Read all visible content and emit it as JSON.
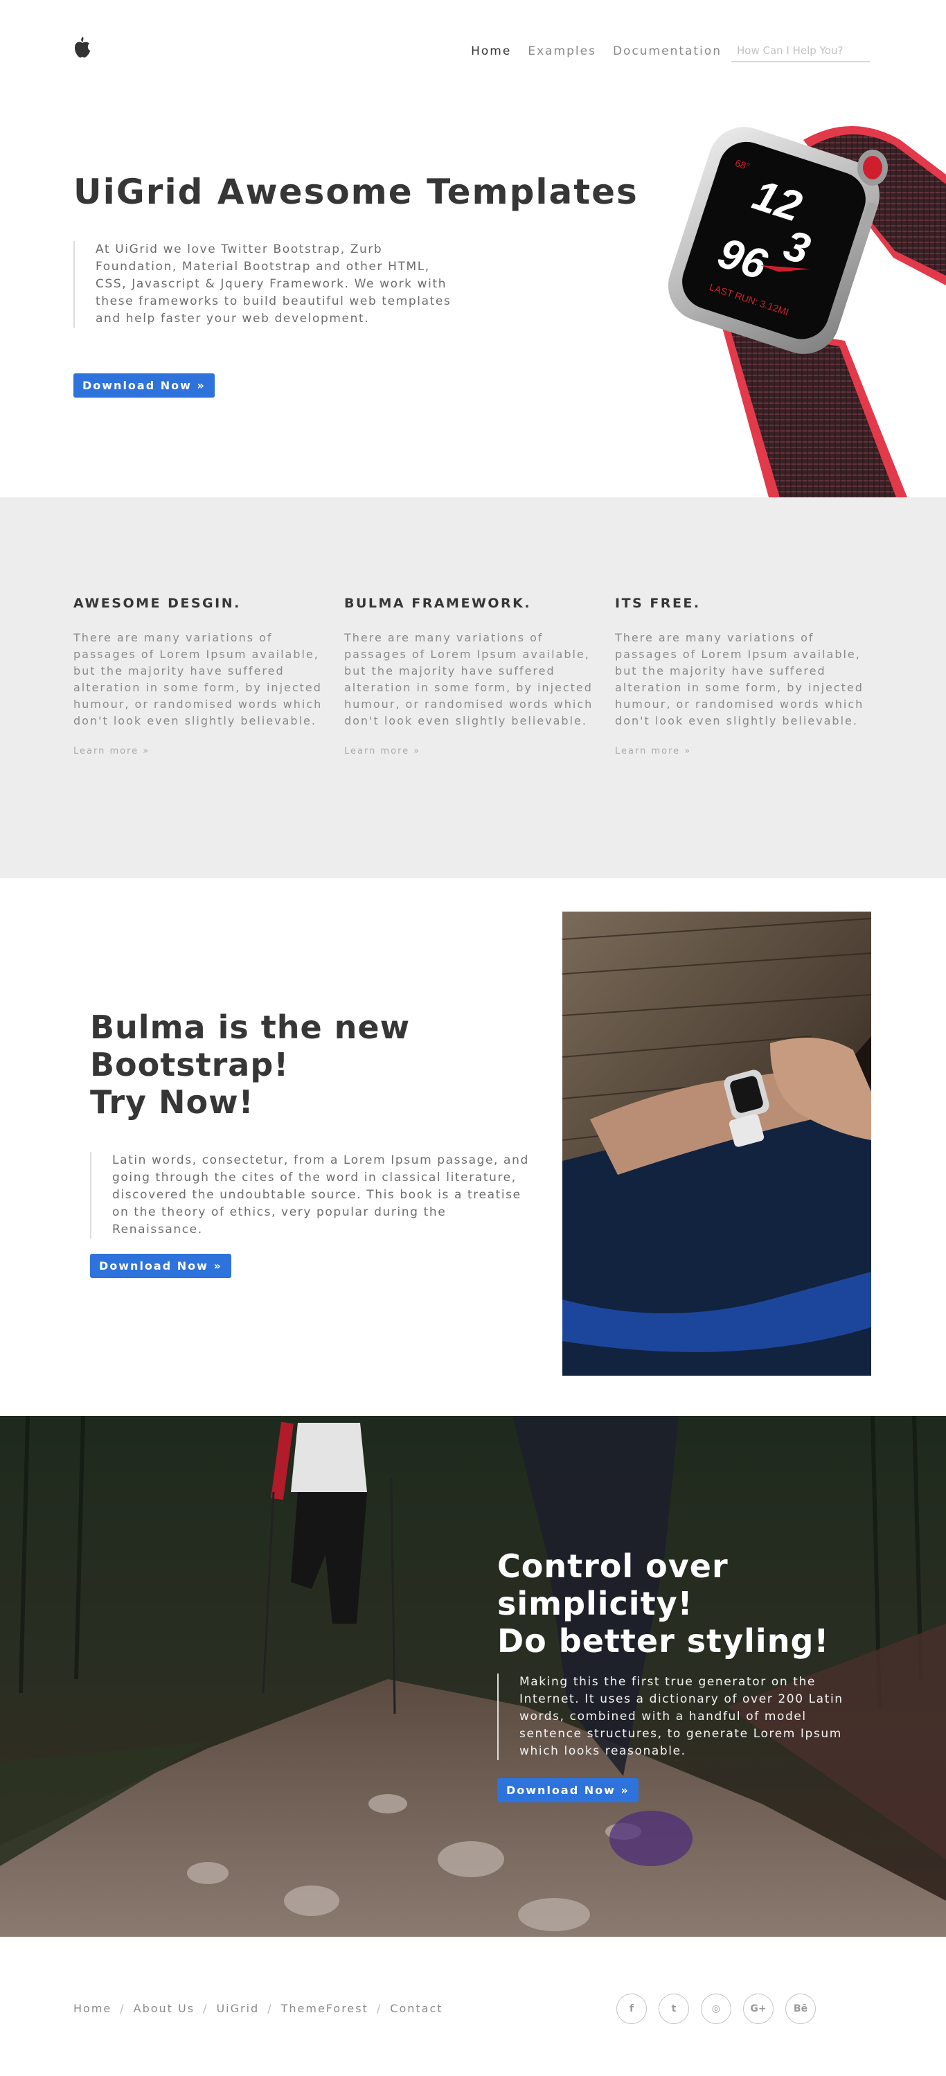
{
  "nav": {
    "logo_icon": "apple-logo",
    "links": [
      {
        "label": "Home",
        "active": true
      },
      {
        "label": "Examples",
        "active": false
      },
      {
        "label": "Documentation",
        "active": false
      }
    ],
    "search_placeholder": "How Can I Help You?"
  },
  "hero": {
    "title": "UiGrid Awesome Templates",
    "text": "At UiGrid we love Twitter Bootstrap, Zurb Foundation, Material Bootstrap and other HTML, CSS, Javascript & Jquery Framework. We work with these frameworks to build beautiful web templates and help faster your web development.",
    "button": "Download Now »"
  },
  "watch_face": {
    "temp": "68°",
    "hour": "12",
    "min_a": "3",
    "min_b": "96",
    "footer": "LAST RUN: 3.12MI"
  },
  "features": [
    {
      "title": "AWESOME DESGIN.",
      "text": "There are many variations of passages of Lorem Ipsum available, but the majority have suffered alteration in some form, by injected humour, or randomised words which don't look even slightly believable.",
      "link": "Learn more »"
    },
    {
      "title": "BULMA FRAMEWORK.",
      "text": "There are many variations of passages of Lorem Ipsum available, but the majority have suffered alteration in some form, by injected humour, or randomised words which don't look even slightly believable.",
      "link": "Learn more »"
    },
    {
      "title": "ITS FREE.",
      "text": "There are many variations of passages of Lorem Ipsum available, but the majority have suffered alteration in some form, by injected humour, or randomised words which don't look even slightly believable.",
      "link": "Learn more »"
    }
  ],
  "bulma": {
    "title_lines": [
      "Bulma is the new",
      "Bootstrap!",
      "Try Now!"
    ],
    "text": "Latin words, consectetur, from a Lorem Ipsum passage, and going through the cites of the word in classical literature, discovered the undoubtable source. This book is a treatise on the theory of ethics, very popular during the Renaissance.",
    "button": "Download Now »"
  },
  "hike": {
    "title_lines": [
      "Control over",
      "simplicity!",
      "Do better styling!"
    ],
    "text": "Making this the first true generator on the Internet. It uses a dictionary of over 200 Latin words, combined with a handful of model sentence structures, to generate Lorem Ipsum which looks reasonable.",
    "button": "Download Now »"
  },
  "footer": {
    "links": [
      "Home",
      "About Us",
      "UiGrid",
      "ThemeForest",
      "Contact"
    ],
    "socials": [
      {
        "icon": "facebook-icon",
        "glyph": "f"
      },
      {
        "icon": "twitter-icon",
        "glyph": "t"
      },
      {
        "icon": "instagram-icon",
        "glyph": "◎"
      },
      {
        "icon": "google-plus-icon",
        "glyph": "G+"
      },
      {
        "icon": "behance-icon",
        "glyph": "Bē"
      }
    ]
  },
  "colors": {
    "primary": "#2d73db",
    "text_dark": "#363636",
    "text_muted": "#8a8a8a",
    "features_bg": "#ededed"
  }
}
